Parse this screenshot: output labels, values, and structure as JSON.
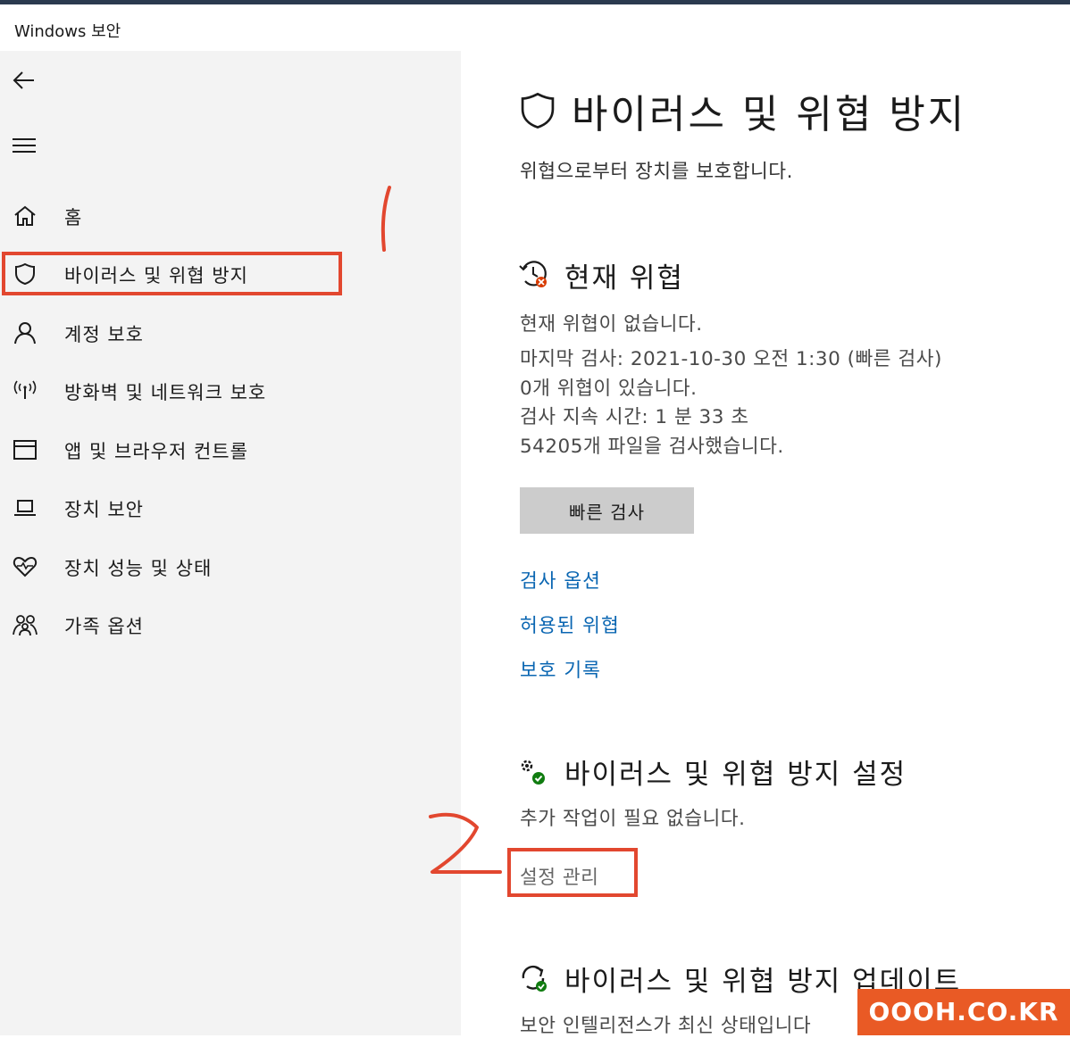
{
  "app": {
    "title": "Windows 보안"
  },
  "sidebar": {
    "back_icon": "back-arrow-icon",
    "menu_icon": "hamburger-icon",
    "items": [
      {
        "label": "홈",
        "icon": "home-icon"
      },
      {
        "label": "바이러스 및 위협 방지",
        "icon": "shield-icon",
        "selected": true
      },
      {
        "label": "계정 보호",
        "icon": "person-icon"
      },
      {
        "label": "방화벽 및 네트워크 보호",
        "icon": "wifi-antenna-icon"
      },
      {
        "label": "앱 및 브라우저 컨트롤",
        "icon": "app-window-icon"
      },
      {
        "label": "장치 보안",
        "icon": "laptop-icon"
      },
      {
        "label": "장치 성능 및 상태",
        "icon": "heart-pulse-icon"
      },
      {
        "label": "가족 옵션",
        "icon": "family-icon"
      }
    ]
  },
  "main": {
    "title": "바이러스 및 위협 방지",
    "subtitle": "위협으로부터 장치를 보호합니다.",
    "current_threats": {
      "heading": "현재 위협",
      "lines": [
        "현재 위협이 없습니다.",
        "마지막 검사: 2021-10-30 오전 1:30 (빠른 검사)",
        "0개 위협이 있습니다.",
        "검사 지속 시간: 1 분 33 초",
        "54205개 파일을 검사했습니다."
      ],
      "quick_scan_button": "빠른 검사",
      "links": [
        "검사 옵션",
        "허용된 위협",
        "보호 기록"
      ]
    },
    "settings": {
      "heading": "바이러스 및 위협 방지 설정",
      "status": "추가 작업이 필요 없습니다.",
      "manage_link": "설정 관리"
    },
    "updates": {
      "heading": "바이러스 및 위협 방지 업데이트",
      "status": "보안 인텔리전스가 최신 상태입니다"
    }
  },
  "annotations": {
    "step1": "1",
    "step2": "2",
    "accent_color": "#e2472f"
  },
  "watermark": "OOOH.CO.KR"
}
